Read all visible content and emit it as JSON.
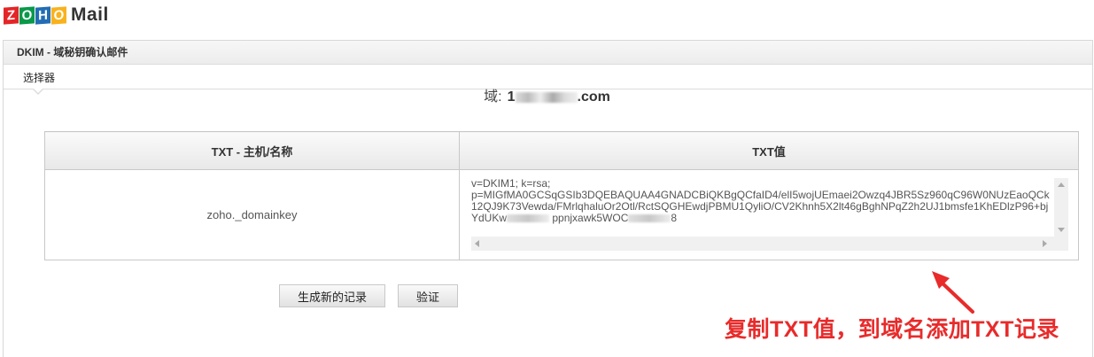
{
  "app": {
    "logo_letters": [
      "Z",
      "O",
      "H",
      "O"
    ],
    "logo_colors": [
      "#e42527",
      "#089949",
      "#226db4",
      "#f9b21d"
    ],
    "logo_text": "Mail"
  },
  "panel": {
    "title": "DKIM - 域秘钥确认邮件",
    "tab_label": "选择器"
  },
  "domain": {
    "label": "域:",
    "value_prefix": "1",
    "value_suffix": ".com"
  },
  "table": {
    "headers": [
      "TXT - 主机/名称",
      "TXT值"
    ],
    "row": {
      "host": "zoho._domainkey",
      "txt_value_visible": "v=DKIM1; k=rsa;\np=MIGfMA0GCSqGSIb3DQEBAQUAA4GNADCBiQKBgQCfaID4/elI5wojUEmaei2Owzq4JBR5Sz960qC96W0NUzEaoQCk12QJ9K73Vewda/FMrlqhaluOr2Otl/RctSQGHEwdjPBMU1QyliO/CV2Khnh5X2lt46gBghNPqZ2h2UJ1bmsfe1KhEDlzP96+bjYdUKw",
      "txt_value_tail_a": "ppnjxawk5WOC",
      "txt_value_tail_b": "8"
    }
  },
  "buttons": {
    "generate": "生成新的记录",
    "verify": "验证"
  },
  "annotation": {
    "text": "复制TXT值，到域名添加TXT记录",
    "color": "#e82b2b"
  }
}
